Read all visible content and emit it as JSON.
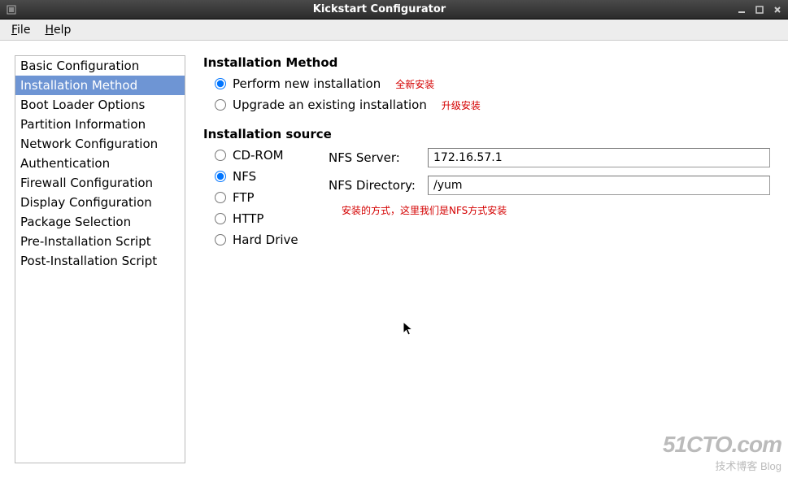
{
  "window": {
    "title": "Kickstart Configurator"
  },
  "menubar": {
    "file": "File",
    "help": "Help"
  },
  "sidebar": {
    "items": [
      "Basic Configuration",
      "Installation Method",
      "Boot Loader Options",
      "Partition Information",
      "Network Configuration",
      "Authentication",
      "Firewall Configuration",
      "Display Configuration",
      "Package Selection",
      "Pre-Installation Script",
      "Post-Installation Script"
    ],
    "selected_index": 1
  },
  "main": {
    "method_title": "Installation Method",
    "method_options": {
      "new_install": "Perform new installation",
      "upgrade": "Upgrade an existing installation"
    },
    "method_selected": "new_install",
    "source_title": "Installation source",
    "source_options": [
      "CD-ROM",
      "NFS",
      "FTP",
      "HTTP",
      "Hard Drive"
    ],
    "source_selected": "NFS",
    "nfs_server_label": "NFS Server:",
    "nfs_server_value": "172.16.57.1",
    "nfs_directory_label": "NFS Directory:",
    "nfs_directory_value": "/yum"
  },
  "annotations": {
    "new_install": "全新安装",
    "upgrade": "升级安装",
    "source_note": "安装的方式，这里我们是NFS方式安装"
  },
  "watermark": {
    "line1": "51CTO.com",
    "line2": "技术博客  Blog"
  }
}
